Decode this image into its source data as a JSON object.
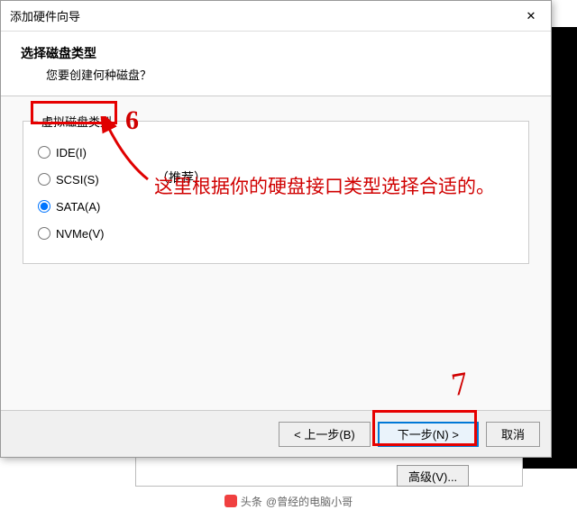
{
  "window": {
    "title": "添加硬件向导",
    "close_glyph": "✕"
  },
  "header": {
    "title": "选择磁盘类型",
    "subtitle": "您要创建何种磁盘？"
  },
  "group": {
    "legend": "虚拟磁盘类型",
    "options": [
      {
        "label": "IDE(I)",
        "checked": false
      },
      {
        "label": "SCSI(S)",
        "checked": false
      },
      {
        "label": "SATA(A)",
        "checked": true
      },
      {
        "label": "NVMe(V)",
        "checked": false
      }
    ],
    "recommend": "（推荐）"
  },
  "annotations": {
    "step_mark": "6",
    "step_7": "7",
    "note": "这里根据你的硬盘接口类型选择合适的。"
  },
  "footer": {
    "back": "< 上一步(B)",
    "next": "下一步(N) >",
    "cancel": "取消"
  },
  "background": {
    "advanced_btn": "高级(V)..."
  },
  "byline": {
    "prefix": "头条",
    "author": "@曾经的电脑小哥"
  }
}
